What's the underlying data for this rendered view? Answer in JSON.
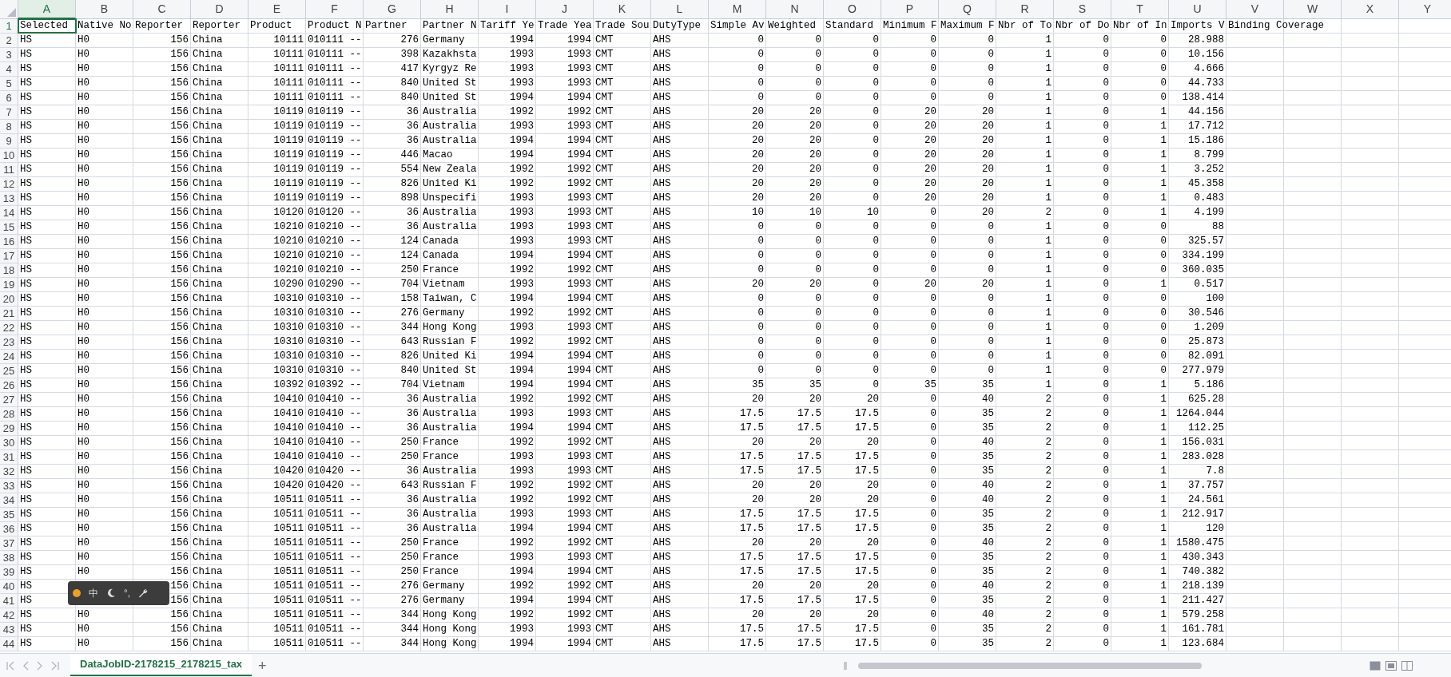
{
  "columns": [
    {
      "letter": "A",
      "kind": "text",
      "selected": true
    },
    {
      "letter": "B",
      "kind": "text",
      "selected": false
    },
    {
      "letter": "C",
      "kind": "number",
      "selected": false
    },
    {
      "letter": "D",
      "kind": "text",
      "selected": false
    },
    {
      "letter": "E",
      "kind": "number",
      "selected": false
    },
    {
      "letter": "F",
      "kind": "text",
      "selected": false
    },
    {
      "letter": "G",
      "kind": "number",
      "selected": false
    },
    {
      "letter": "H",
      "kind": "text",
      "selected": false
    },
    {
      "letter": "I",
      "kind": "number",
      "selected": false
    },
    {
      "letter": "J",
      "kind": "number",
      "selected": false
    },
    {
      "letter": "K",
      "kind": "text",
      "selected": false
    },
    {
      "letter": "L",
      "kind": "text",
      "selected": false
    },
    {
      "letter": "M",
      "kind": "number",
      "selected": false
    },
    {
      "letter": "N",
      "kind": "number",
      "selected": false
    },
    {
      "letter": "O",
      "kind": "number",
      "selected": false
    },
    {
      "letter": "P",
      "kind": "number",
      "selected": false
    },
    {
      "letter": "Q",
      "kind": "number",
      "selected": false
    },
    {
      "letter": "R",
      "kind": "number",
      "selected": false
    },
    {
      "letter": "S",
      "kind": "number",
      "selected": false
    },
    {
      "letter": "T",
      "kind": "number",
      "selected": false
    },
    {
      "letter": "U",
      "kind": "number",
      "selected": false
    },
    {
      "letter": "V",
      "kind": "text",
      "selected": false
    },
    {
      "letter": "W",
      "kind": "text",
      "selected": false
    },
    {
      "letter": "X",
      "kind": "text",
      "selected": false
    },
    {
      "letter": "Y",
      "kind": "text",
      "selected": false
    }
  ],
  "header_row": {
    "number": "1",
    "selected": true,
    "cells": [
      "Selected",
      "Native No",
      "Reporter",
      "Reporter",
      "Product",
      "Product N",
      "Partner",
      "Partner N",
      "Tariff Ye",
      "Trade Yea",
      "Trade Sou",
      "DutyType",
      "Simple Av",
      "Weighted",
      "Standard",
      "Minimum F",
      "Maximum F",
      "Nbr of To",
      "Nbr of Do",
      "Nbr of In",
      "Imports V",
      "Binding Coverage"
    ]
  },
  "rows": [
    {
      "number": "2",
      "selected": false,
      "cells": [
        "HS",
        "H0",
        "156",
        "China",
        "10111",
        "010111 --",
        "276",
        "Germany",
        "1994",
        "1994",
        "CMT",
        "AHS",
        "0",
        "0",
        "0",
        "0",
        "0",
        "1",
        "0",
        "0",
        "28.988"
      ]
    },
    {
      "number": "3",
      "selected": false,
      "cells": [
        "HS",
        "H0",
        "156",
        "China",
        "10111",
        "010111 --",
        "398",
        "Kazakhsta",
        "1993",
        "1993",
        "CMT",
        "AHS",
        "0",
        "0",
        "0",
        "0",
        "0",
        "1",
        "0",
        "0",
        "10.156"
      ]
    },
    {
      "number": "4",
      "selected": false,
      "cells": [
        "HS",
        "H0",
        "156",
        "China",
        "10111",
        "010111 --",
        "417",
        "Kyrgyz Re",
        "1993",
        "1993",
        "CMT",
        "AHS",
        "0",
        "0",
        "0",
        "0",
        "0",
        "1",
        "0",
        "0",
        "4.666"
      ]
    },
    {
      "number": "5",
      "selected": false,
      "cells": [
        "HS",
        "H0",
        "156",
        "China",
        "10111",
        "010111 --",
        "840",
        "United St",
        "1993",
        "1993",
        "CMT",
        "AHS",
        "0",
        "0",
        "0",
        "0",
        "0",
        "1",
        "0",
        "0",
        "44.733"
      ]
    },
    {
      "number": "6",
      "selected": false,
      "cells": [
        "HS",
        "H0",
        "156",
        "China",
        "10111",
        "010111 --",
        "840",
        "United St",
        "1994",
        "1994",
        "CMT",
        "AHS",
        "0",
        "0",
        "0",
        "0",
        "0",
        "1",
        "0",
        "0",
        "138.414"
      ]
    },
    {
      "number": "7",
      "selected": false,
      "cells": [
        "HS",
        "H0",
        "156",
        "China",
        "10119",
        "010119 --",
        "36",
        "Australia",
        "1992",
        "1992",
        "CMT",
        "AHS",
        "20",
        "20",
        "0",
        "20",
        "20",
        "1",
        "0",
        "1",
        "44.156"
      ]
    },
    {
      "number": "8",
      "selected": false,
      "cells": [
        "HS",
        "H0",
        "156",
        "China",
        "10119",
        "010119 --",
        "36",
        "Australia",
        "1993",
        "1993",
        "CMT",
        "AHS",
        "20",
        "20",
        "0",
        "20",
        "20",
        "1",
        "0",
        "1",
        "17.712"
      ]
    },
    {
      "number": "9",
      "selected": false,
      "cells": [
        "HS",
        "H0",
        "156",
        "China",
        "10119",
        "010119 --",
        "36",
        "Australia",
        "1994",
        "1994",
        "CMT",
        "AHS",
        "20",
        "20",
        "0",
        "20",
        "20",
        "1",
        "0",
        "1",
        "15.186"
      ]
    },
    {
      "number": "10",
      "selected": false,
      "cells": [
        "HS",
        "H0",
        "156",
        "China",
        "10119",
        "010119 --",
        "446",
        "Macao",
        "1994",
        "1994",
        "CMT",
        "AHS",
        "20",
        "20",
        "0",
        "20",
        "20",
        "1",
        "0",
        "1",
        "8.799"
      ]
    },
    {
      "number": "11",
      "selected": false,
      "cells": [
        "HS",
        "H0",
        "156",
        "China",
        "10119",
        "010119 --",
        "554",
        "New Zeala",
        "1992",
        "1992",
        "CMT",
        "AHS",
        "20",
        "20",
        "0",
        "20",
        "20",
        "1",
        "0",
        "1",
        "3.252"
      ]
    },
    {
      "number": "12",
      "selected": false,
      "cells": [
        "HS",
        "H0",
        "156",
        "China",
        "10119",
        "010119 --",
        "826",
        "United Ki",
        "1992",
        "1992",
        "CMT",
        "AHS",
        "20",
        "20",
        "0",
        "20",
        "20",
        "1",
        "0",
        "1",
        "45.358"
      ]
    },
    {
      "number": "13",
      "selected": false,
      "cells": [
        "HS",
        "H0",
        "156",
        "China",
        "10119",
        "010119 --",
        "898",
        "Unspecifi",
        "1993",
        "1993",
        "CMT",
        "AHS",
        "20",
        "20",
        "0",
        "20",
        "20",
        "1",
        "0",
        "1",
        "0.483"
      ]
    },
    {
      "number": "14",
      "selected": false,
      "cells": [
        "HS",
        "H0",
        "156",
        "China",
        "10120",
        "010120 --",
        "36",
        "Australia",
        "1993",
        "1993",
        "CMT",
        "AHS",
        "10",
        "10",
        "10",
        "0",
        "20",
        "2",
        "0",
        "1",
        "4.199"
      ]
    },
    {
      "number": "15",
      "selected": false,
      "cells": [
        "HS",
        "H0",
        "156",
        "China",
        "10210",
        "010210 --",
        "36",
        "Australia",
        "1993",
        "1993",
        "CMT",
        "AHS",
        "0",
        "0",
        "0",
        "0",
        "0",
        "1",
        "0",
        "0",
        "88"
      ]
    },
    {
      "number": "16",
      "selected": false,
      "cells": [
        "HS",
        "H0",
        "156",
        "China",
        "10210",
        "010210 --",
        "124",
        "Canada",
        "1993",
        "1993",
        "CMT",
        "AHS",
        "0",
        "0",
        "0",
        "0",
        "0",
        "1",
        "0",
        "0",
        "325.57"
      ]
    },
    {
      "number": "17",
      "selected": false,
      "cells": [
        "HS",
        "H0",
        "156",
        "China",
        "10210",
        "010210 --",
        "124",
        "Canada",
        "1994",
        "1994",
        "CMT",
        "AHS",
        "0",
        "0",
        "0",
        "0",
        "0",
        "1",
        "0",
        "0",
        "334.199"
      ]
    },
    {
      "number": "18",
      "selected": false,
      "cells": [
        "HS",
        "H0",
        "156",
        "China",
        "10210",
        "010210 --",
        "250",
        "France",
        "1992",
        "1992",
        "CMT",
        "AHS",
        "0",
        "0",
        "0",
        "0",
        "0",
        "1",
        "0",
        "0",
        "360.035"
      ]
    },
    {
      "number": "19",
      "selected": false,
      "cells": [
        "HS",
        "H0",
        "156",
        "China",
        "10290",
        "010290 --",
        "704",
        "Vietnam",
        "1993",
        "1993",
        "CMT",
        "AHS",
        "20",
        "20",
        "0",
        "20",
        "20",
        "1",
        "0",
        "1",
        "0.517"
      ]
    },
    {
      "number": "20",
      "selected": false,
      "cells": [
        "HS",
        "H0",
        "156",
        "China",
        "10310",
        "010310 --",
        "158",
        "Taiwan, C",
        "1994",
        "1994",
        "CMT",
        "AHS",
        "0",
        "0",
        "0",
        "0",
        "0",
        "1",
        "0",
        "0",
        "100"
      ]
    },
    {
      "number": "21",
      "selected": false,
      "cells": [
        "HS",
        "H0",
        "156",
        "China",
        "10310",
        "010310 --",
        "276",
        "Germany",
        "1992",
        "1992",
        "CMT",
        "AHS",
        "0",
        "0",
        "0",
        "0",
        "0",
        "1",
        "0",
        "0",
        "30.546"
      ]
    },
    {
      "number": "22",
      "selected": false,
      "cells": [
        "HS",
        "H0",
        "156",
        "China",
        "10310",
        "010310 --",
        "344",
        "Hong Kong",
        "1993",
        "1993",
        "CMT",
        "AHS",
        "0",
        "0",
        "0",
        "0",
        "0",
        "1",
        "0",
        "0",
        "1.209"
      ]
    },
    {
      "number": "23",
      "selected": false,
      "cells": [
        "HS",
        "H0",
        "156",
        "China",
        "10310",
        "010310 --",
        "643",
        "Russian F",
        "1992",
        "1992",
        "CMT",
        "AHS",
        "0",
        "0",
        "0",
        "0",
        "0",
        "1",
        "0",
        "0",
        "25.873"
      ]
    },
    {
      "number": "24",
      "selected": false,
      "cells": [
        "HS",
        "H0",
        "156",
        "China",
        "10310",
        "010310 --",
        "826",
        "United Ki",
        "1994",
        "1994",
        "CMT",
        "AHS",
        "0",
        "0",
        "0",
        "0",
        "0",
        "1",
        "0",
        "0",
        "82.091"
      ]
    },
    {
      "number": "25",
      "selected": false,
      "cells": [
        "HS",
        "H0",
        "156",
        "China",
        "10310",
        "010310 --",
        "840",
        "United St",
        "1994",
        "1994",
        "CMT",
        "AHS",
        "0",
        "0",
        "0",
        "0",
        "0",
        "1",
        "0",
        "0",
        "277.979"
      ]
    },
    {
      "number": "26",
      "selected": false,
      "cells": [
        "HS",
        "H0",
        "156",
        "China",
        "10392",
        "010392 --",
        "704",
        "Vietnam",
        "1994",
        "1994",
        "CMT",
        "AHS",
        "35",
        "35",
        "0",
        "35",
        "35",
        "1",
        "0",
        "1",
        "5.186"
      ]
    },
    {
      "number": "27",
      "selected": false,
      "cells": [
        "HS",
        "H0",
        "156",
        "China",
        "10410",
        "010410 --",
        "36",
        "Australia",
        "1992",
        "1992",
        "CMT",
        "AHS",
        "20",
        "20",
        "20",
        "0",
        "40",
        "2",
        "0",
        "1",
        "625.28"
      ]
    },
    {
      "number": "28",
      "selected": false,
      "cells": [
        "HS",
        "H0",
        "156",
        "China",
        "10410",
        "010410 --",
        "36",
        "Australia",
        "1993",
        "1993",
        "CMT",
        "AHS",
        "17.5",
        "17.5",
        "17.5",
        "0",
        "35",
        "2",
        "0",
        "1",
        "1264.044"
      ]
    },
    {
      "number": "29",
      "selected": false,
      "cells": [
        "HS",
        "H0",
        "156",
        "China",
        "10410",
        "010410 --",
        "36",
        "Australia",
        "1994",
        "1994",
        "CMT",
        "AHS",
        "17.5",
        "17.5",
        "17.5",
        "0",
        "35",
        "2",
        "0",
        "1",
        "112.25"
      ]
    },
    {
      "number": "30",
      "selected": false,
      "cells": [
        "HS",
        "H0",
        "156",
        "China",
        "10410",
        "010410 --",
        "250",
        "France",
        "1992",
        "1992",
        "CMT",
        "AHS",
        "20",
        "20",
        "20",
        "0",
        "40",
        "2",
        "0",
        "1",
        "156.031"
      ]
    },
    {
      "number": "31",
      "selected": false,
      "cells": [
        "HS",
        "H0",
        "156",
        "China",
        "10410",
        "010410 --",
        "250",
        "France",
        "1993",
        "1993",
        "CMT",
        "AHS",
        "17.5",
        "17.5",
        "17.5",
        "0",
        "35",
        "2",
        "0",
        "1",
        "283.028"
      ]
    },
    {
      "number": "32",
      "selected": false,
      "cells": [
        "HS",
        "H0",
        "156",
        "China",
        "10420",
        "010420 --",
        "36",
        "Australia",
        "1993",
        "1993",
        "CMT",
        "AHS",
        "17.5",
        "17.5",
        "17.5",
        "0",
        "35",
        "2",
        "0",
        "1",
        "7.8"
      ]
    },
    {
      "number": "33",
      "selected": false,
      "cells": [
        "HS",
        "H0",
        "156",
        "China",
        "10420",
        "010420 --",
        "643",
        "Russian F",
        "1992",
        "1992",
        "CMT",
        "AHS",
        "20",
        "20",
        "20",
        "0",
        "40",
        "2",
        "0",
        "1",
        "37.757"
      ]
    },
    {
      "number": "34",
      "selected": false,
      "cells": [
        "HS",
        "H0",
        "156",
        "China",
        "10511",
        "010511 --",
        "36",
        "Australia",
        "1992",
        "1992",
        "CMT",
        "AHS",
        "20",
        "20",
        "20",
        "0",
        "40",
        "2",
        "0",
        "1",
        "24.561"
      ]
    },
    {
      "number": "35",
      "selected": false,
      "cells": [
        "HS",
        "H0",
        "156",
        "China",
        "10511",
        "010511 --",
        "36",
        "Australia",
        "1993",
        "1993",
        "CMT",
        "AHS",
        "17.5",
        "17.5",
        "17.5",
        "0",
        "35",
        "2",
        "0",
        "1",
        "212.917"
      ]
    },
    {
      "number": "36",
      "selected": false,
      "cells": [
        "HS",
        "H0",
        "156",
        "China",
        "10511",
        "010511 --",
        "36",
        "Australia",
        "1994",
        "1994",
        "CMT",
        "AHS",
        "17.5",
        "17.5",
        "17.5",
        "0",
        "35",
        "2",
        "0",
        "1",
        "120"
      ]
    },
    {
      "number": "37",
      "selected": false,
      "cells": [
        "HS",
        "H0",
        "156",
        "China",
        "10511",
        "010511 --",
        "250",
        "France",
        "1992",
        "1992",
        "CMT",
        "AHS",
        "20",
        "20",
        "20",
        "0",
        "40",
        "2",
        "0",
        "1",
        "1580.475"
      ]
    },
    {
      "number": "38",
      "selected": false,
      "cells": [
        "HS",
        "H0",
        "156",
        "China",
        "10511",
        "010511 --",
        "250",
        "France",
        "1993",
        "1993",
        "CMT",
        "AHS",
        "17.5",
        "17.5",
        "17.5",
        "0",
        "35",
        "2",
        "0",
        "1",
        "430.343"
      ]
    },
    {
      "number": "39",
      "selected": false,
      "cells": [
        "HS",
        "H0",
        "156",
        "China",
        "10511",
        "010511 --",
        "250",
        "France",
        "1994",
        "1994",
        "CMT",
        "AHS",
        "17.5",
        "17.5",
        "17.5",
        "0",
        "35",
        "2",
        "0",
        "1",
        "740.382"
      ]
    },
    {
      "number": "40",
      "selected": false,
      "cells": [
        "HS",
        null,
        "156",
        "China",
        "10511",
        "010511 --",
        "276",
        "Germany",
        "1992",
        "1992",
        "CMT",
        "AHS",
        "20",
        "20",
        "20",
        "0",
        "40",
        "2",
        "0",
        "1",
        "218.139"
      ]
    },
    {
      "number": "41",
      "selected": false,
      "cells": [
        "HS",
        null,
        "156",
        "China",
        "10511",
        "010511 --",
        "276",
        "Germany",
        "1994",
        "1994",
        "CMT",
        "AHS",
        "17.5",
        "17.5",
        "17.5",
        "0",
        "35",
        "2",
        "0",
        "1",
        "211.427"
      ]
    },
    {
      "number": "42",
      "selected": false,
      "cells": [
        "HS",
        "H0",
        "156",
        "China",
        "10511",
        "010511 --",
        "344",
        "Hong Kong",
        "1992",
        "1992",
        "CMT",
        "AHS",
        "20",
        "20",
        "20",
        "0",
        "40",
        "2",
        "0",
        "1",
        "579.258"
      ]
    },
    {
      "number": "43",
      "selected": false,
      "cells": [
        "HS",
        "H0",
        "156",
        "China",
        "10511",
        "010511 --",
        "344",
        "Hong Kong",
        "1993",
        "1993",
        "CMT",
        "AHS",
        "17.5",
        "17.5",
        "17.5",
        "0",
        "35",
        "2",
        "0",
        "1",
        "161.781"
      ]
    },
    {
      "number": "44",
      "selected": false,
      "cells": [
        "HS",
        "H0",
        "156",
        "China",
        "10511",
        "010511 --",
        "344",
        "Hong Kong",
        "1994",
        "1994",
        "CMT",
        "AHS",
        "17.5",
        "17.5",
        "17.5",
        "0",
        "35",
        "2",
        "0",
        "1",
        "123.684"
      ]
    }
  ],
  "ime_toolbar": {
    "mode": "中",
    "punctuation": "°,"
  },
  "sheet_tabs": [
    {
      "label": "DataJobID-2178215_2178215_tax",
      "selected": true
    }
  ],
  "add_sheet": "+"
}
